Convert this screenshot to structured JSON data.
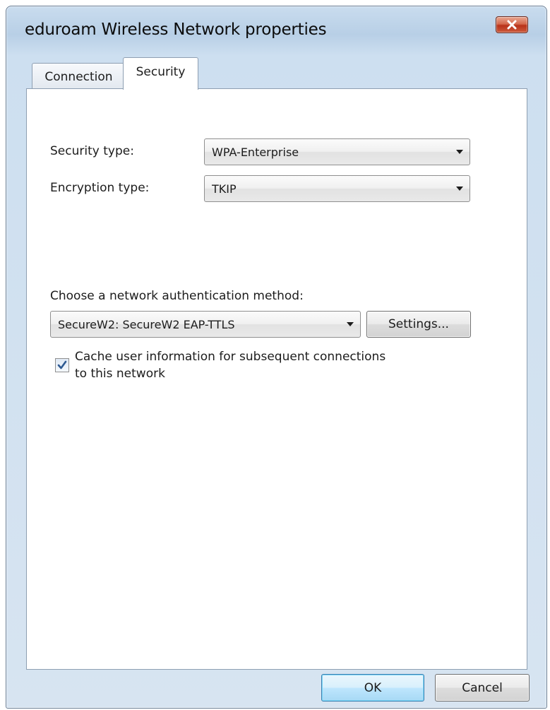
{
  "window": {
    "title": "eduroam Wireless Network properties",
    "close_icon": "close-icon"
  },
  "tabs": [
    {
      "label": "Connection",
      "selected": false
    },
    {
      "label": "Security",
      "selected": true
    }
  ],
  "security": {
    "security_type_label": "Security type:",
    "security_type_value": "WPA-Enterprise",
    "encryption_type_label": "Encryption type:",
    "encryption_type_value": "TKIP"
  },
  "auth": {
    "label": "Choose a network authentication method:",
    "method_value": "SecureW2: SecureW2 EAP-TTLS",
    "settings_button": "Settings..."
  },
  "cache": {
    "checked": true,
    "label_line1": "Cache user information for subsequent connections",
    "label_line2": "to this network"
  },
  "footer": {
    "ok_label": "OK",
    "cancel_label": "Cancel"
  },
  "colors": {
    "title_bar": "#b8cfe6",
    "close_button": "#c9472b",
    "ok_button": "#bee6fd",
    "checkbox_check": "#2e5a92"
  }
}
